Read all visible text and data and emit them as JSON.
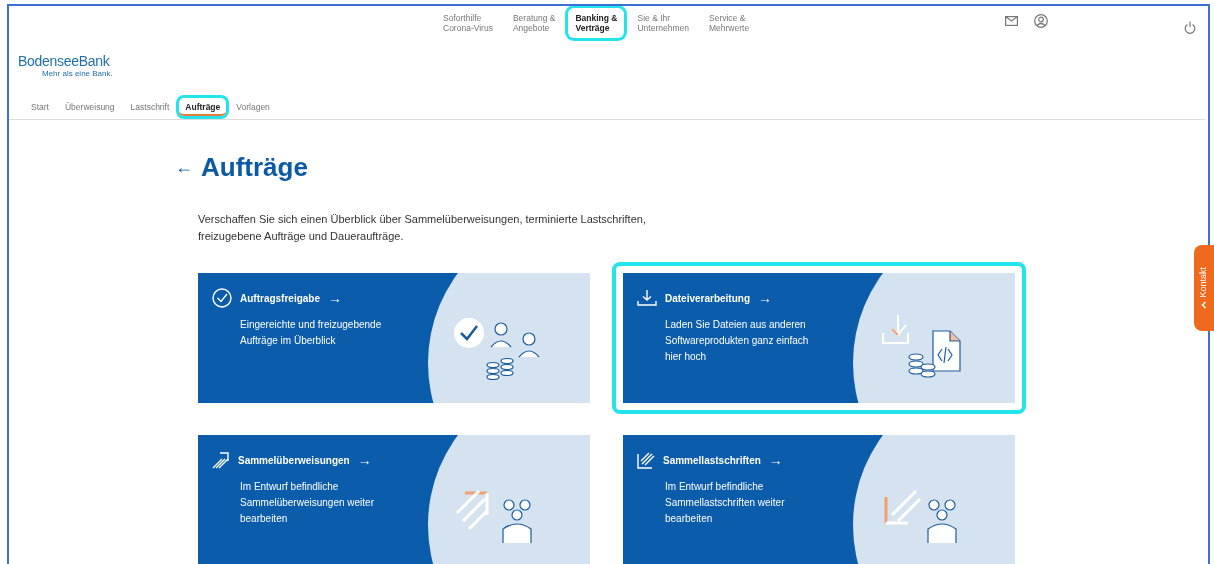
{
  "top_nav": [
    {
      "label": "Soforthilfe\nCorona-Virus",
      "selected": false,
      "highlighted": false
    },
    {
      "label": "Beratung &\nAngebote",
      "selected": false,
      "highlighted": false
    },
    {
      "label": "Banking &\nVerträge",
      "selected": true,
      "highlighted": true
    },
    {
      "label": "Sie & Ihr\nUnternehmen",
      "selected": false,
      "highlighted": false
    },
    {
      "label": "Service &\nMehrwerte",
      "selected": false,
      "highlighted": false
    }
  ],
  "logo": {
    "name": "BodenseeBank",
    "tagline": "Mehr als eine Bank."
  },
  "tabs": [
    {
      "label": "Start",
      "selected": false,
      "highlighted": false
    },
    {
      "label": "Überweisung",
      "selected": false,
      "highlighted": false
    },
    {
      "label": "Lastschrift",
      "selected": false,
      "highlighted": false
    },
    {
      "label": "Aufträge",
      "selected": true,
      "highlighted": true
    },
    {
      "label": "Vorlagen",
      "selected": false,
      "highlighted": false
    }
  ],
  "page": {
    "back": "←",
    "title": "Aufträge",
    "intro": "Verschaffen Sie sich einen Überblick über Sammelüberweisungen, terminierte Lastschriften,\nfreizugebene Aufträge und Daueraufträge."
  },
  "cards": [
    {
      "kind": "release",
      "title": "Auftragsfreigabe",
      "arrow": "→",
      "text": "Eingereichte und freizugebende\nAufträge im Überblick",
      "highlighted": false
    },
    {
      "kind": "upload",
      "title": "Dateiverarbeitung",
      "arrow": "→",
      "text": "Laden Sie Dateien aus anderen\nSoftwareprodukten ganz einfach\nhier hoch",
      "highlighted": true
    },
    {
      "kind": "transfer",
      "title": "Sammelüberweisungen",
      "arrow": "→",
      "text": "Im Entwurf befindliche\nSammelüberweisungen weiter\nbearbeiten",
      "highlighted": false
    },
    {
      "kind": "debit",
      "title": "Sammellastschriften",
      "arrow": "→",
      "text": "Im Entwurf befindliche\nSammellastschriften weiter\nbearbeiten",
      "highlighted": false
    }
  ],
  "contact_tab": {
    "label": "Kontakt"
  }
}
